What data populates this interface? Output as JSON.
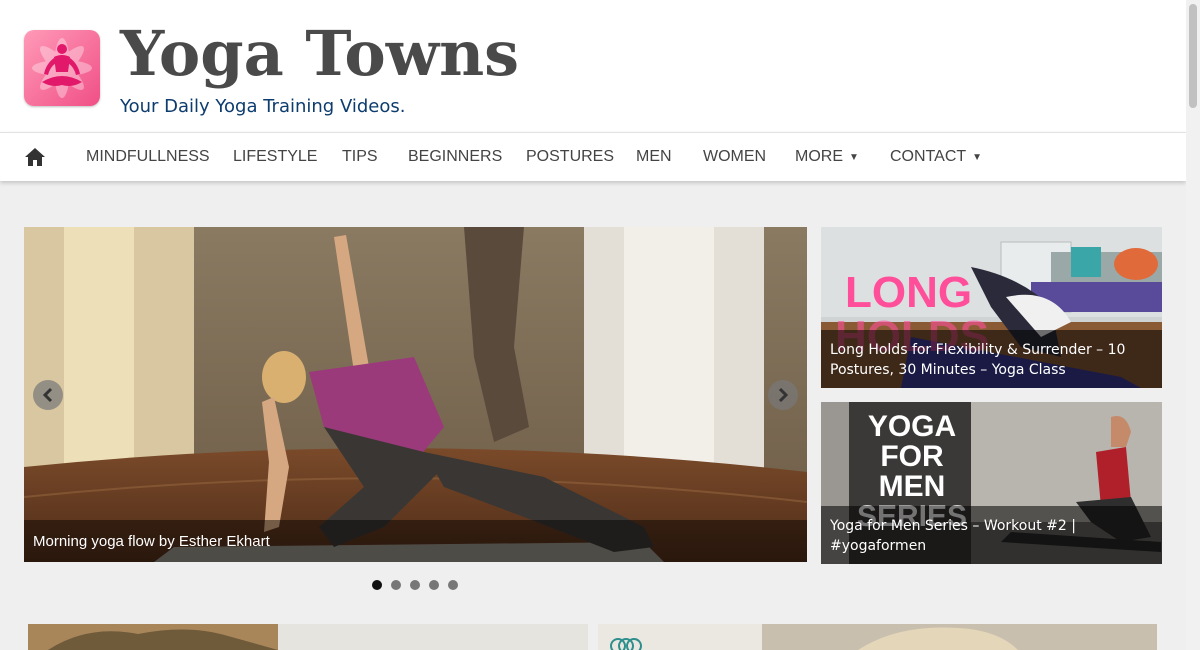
{
  "site": {
    "title": "Yoga Towns",
    "tagline": "Your Daily Yoga Training Videos."
  },
  "nav": {
    "home_icon": "home-icon",
    "items": [
      {
        "label": "MINDFULLNESS"
      },
      {
        "label": "LIFESTYLE"
      },
      {
        "label": "TIPS"
      },
      {
        "label": "BEGINNERS"
      },
      {
        "label": "POSTURES"
      },
      {
        "label": "MEN"
      },
      {
        "label": "WOMEN"
      },
      {
        "label": "MORE",
        "dropdown": true
      },
      {
        "label": "CONTACT",
        "dropdown": true
      }
    ],
    "caret": "▼"
  },
  "slider": {
    "caption": "Morning yoga flow by Esther Ekhart",
    "slide_count": 5,
    "active_slide": 1,
    "prev_icon": "chevron-left-icon",
    "next_icon": "chevron-right-icon"
  },
  "featured": [
    {
      "overlay": "LONG",
      "overlay2": "HOLDS",
      "caption": "Long Holds for Flexibility & Surrender – 10 Postures, 30 Minutes – Yoga Class"
    },
    {
      "overlay_lines": [
        "YOGA",
        "FOR",
        "MEN",
        "SERIES"
      ],
      "caption": "Yoga for Men Series – Workout #2 | #yogaformen"
    }
  ],
  "colors": {
    "background": "#efefef",
    "title": "#4a4a4a",
    "tagline": "#0d3c6e",
    "logo_pink": "#f04f86",
    "overlay_pink": "#ff4f9a"
  }
}
